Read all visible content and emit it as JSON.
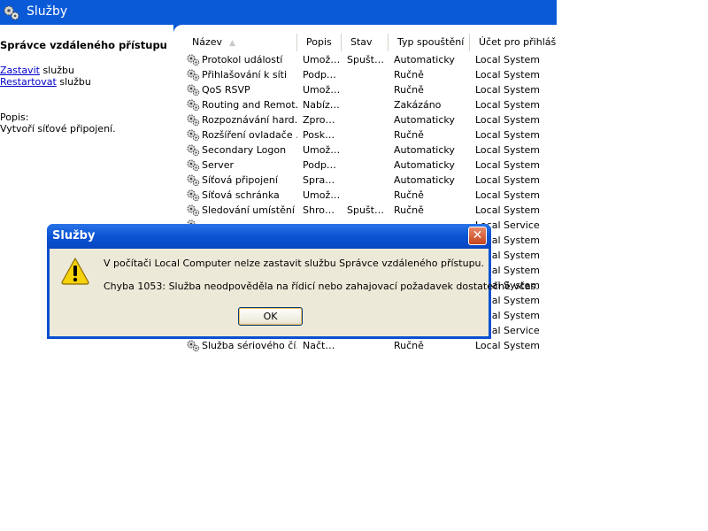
{
  "window": {
    "title": "Služby",
    "title_bar_color": "#0a5ad8"
  },
  "left_panel": {
    "service_name": "Správce vzdáleného přístupu",
    "actions": [
      {
        "link": "Zastavit",
        "suffix": " službu"
      },
      {
        "link": "Restartovat",
        "suffix": " službu"
      }
    ],
    "description_label": "Popis:",
    "description": "Vytvoří síťové připojení."
  },
  "list": {
    "columns": [
      "Název",
      "Popis",
      "Stav",
      "Typ spouštění",
      "Účet pro přihlášení"
    ],
    "sort_indicator": "▲",
    "rows": [
      {
        "name": "Protokol událostí",
        "desc": "Umož…",
        "status": "Spušt…",
        "startup": "Automaticky",
        "account": "Local System"
      },
      {
        "name": "Přihlašování k síti",
        "desc": "Podp…",
        "status": "",
        "startup": "Ručně",
        "account": "Local System"
      },
      {
        "name": "QoS RSVP",
        "desc": "Umož…",
        "status": "",
        "startup": "Ručně",
        "account": "Local System"
      },
      {
        "name": "Routing and Remot…",
        "desc": "Nabíz…",
        "status": "",
        "startup": "Zakázáno",
        "account": "Local System"
      },
      {
        "name": "Rozpoznávání hard…",
        "desc": "Zpro…",
        "status": "",
        "startup": "Automaticky",
        "account": "Local System"
      },
      {
        "name": "Rozšíření ovladače …",
        "desc": "Posk…",
        "status": "",
        "startup": "Ručně",
        "account": "Local System"
      },
      {
        "name": "Secondary Logon",
        "desc": "Umož…",
        "status": "",
        "startup": "Automaticky",
        "account": "Local System"
      },
      {
        "name": "Server",
        "desc": "Podp…",
        "status": "",
        "startup": "Automaticky",
        "account": "Local System"
      },
      {
        "name": "Síťová připojení",
        "desc": "Spra…",
        "status": "",
        "startup": "Automaticky",
        "account": "Local System"
      },
      {
        "name": "Síťová schránka",
        "desc": "Umož…",
        "status": "",
        "startup": "Ručně",
        "account": "Local System"
      },
      {
        "name": "Sledování umístění …",
        "desc": "Shro…",
        "status": "Spušt…",
        "startup": "Ručně",
        "account": "Local System"
      },
      {
        "name": "",
        "desc": "",
        "status": "",
        "startup": "",
        "account": "Local Service"
      },
      {
        "name": "",
        "desc": "",
        "status": "",
        "startup": "",
        "account": "Local System"
      },
      {
        "name": "",
        "desc": "",
        "status": "",
        "startup": "",
        "account": "Local System"
      },
      {
        "name": "",
        "desc": "",
        "status": "",
        "startup": "",
        "account": "Local System"
      },
      {
        "name": "",
        "desc": "",
        "status": "",
        "startup": "",
        "account": "Local System"
      },
      {
        "name": "",
        "desc": "",
        "status": "",
        "startup": "",
        "account": "Local System"
      },
      {
        "name": "",
        "desc": "",
        "status": "",
        "startup": "",
        "account": "Local System"
      },
      {
        "name": "",
        "desc": "",
        "status": "",
        "startup": "",
        "account": "Local Service"
      },
      {
        "name": "Služba sériového čí…",
        "desc": "Načt…",
        "status": "",
        "startup": "Ručně",
        "account": "Local System"
      }
    ]
  },
  "dialog": {
    "title": "Služby",
    "icon": "warning-icon",
    "message": "V počítači Local Computer nelze zastavit službu Správce vzdáleného přístupu.",
    "error": "Chyba 1053: Služba neodpověděla na řídicí nebo zahajovací požadavek dostatečně včas.",
    "ok_label": "OK",
    "close_glyph": "✕"
  }
}
